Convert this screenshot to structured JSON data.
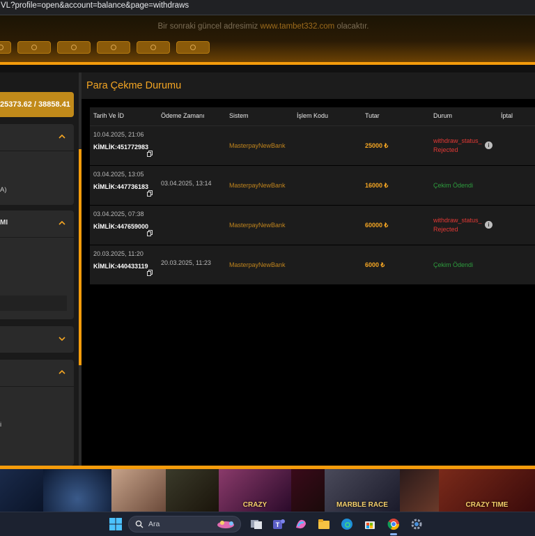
{
  "browser": {
    "url": "VL?profile=open&account=balance&page=withdraws"
  },
  "header": {
    "notice_prefix": "Bir sonraki güncel adresimiz ",
    "notice_link": "www.tambet332.com",
    "notice_suffix": " olacaktır."
  },
  "sidebar": {
    "balance": "25373.62 / 38858.41",
    "section2_item": "A)",
    "section3_title": "MI",
    "section5_item": "i"
  },
  "main": {
    "title": "Para Çekme Durumu",
    "columns": [
      "Tarih Ve İD",
      "Ödeme Zamanı",
      "Sistem",
      "İşlem Kodu",
      "Tutar",
      "Durum",
      "İptal"
    ],
    "rows": [
      {
        "date": "10.04.2025, 21:06",
        "kimlik": "KİMLİK:451772983",
        "paytime": "",
        "system": "MasterpayNewBank",
        "amount": "25000 ₺",
        "status1": "withdraw_status_",
        "status2": "Rejected",
        "type": "rejected"
      },
      {
        "date": "03.04.2025, 13:05",
        "kimlik": "KİMLİK:447736183",
        "paytime": "03.04.2025, 13:14",
        "system": "MasterpayNewBank",
        "amount": "16000 ₺",
        "status1": "Çekim Ödendi",
        "status2": "",
        "type": "ok"
      },
      {
        "date": "03.04.2025, 07:38",
        "kimlik": "KİMLİK:447659000",
        "paytime": "",
        "system": "MasterpayNewBank",
        "amount": "60000 ₺",
        "status1": "withdraw_status_",
        "status2": "Rejected",
        "type": "rejected"
      },
      {
        "date": "20.03.2025, 11:20",
        "kimlik": "KİMLİK:440433119",
        "paytime": "20.03.2025, 11:23",
        "system": "MasterpayNewBank",
        "amount": "6000 ₺",
        "status1": "Çekim Ödendi",
        "status2": "",
        "type": "ok"
      }
    ]
  },
  "games": {
    "captions": [
      "",
      "",
      "",
      "CRAZY",
      "",
      "MARBLE RACE",
      "",
      "CRAZY TIME"
    ]
  },
  "taskbar": {
    "search_text": "Ara"
  },
  "colors": {
    "accent": "#f59c0b",
    "rejected": "#e53935",
    "paid": "#2e9d3e"
  }
}
